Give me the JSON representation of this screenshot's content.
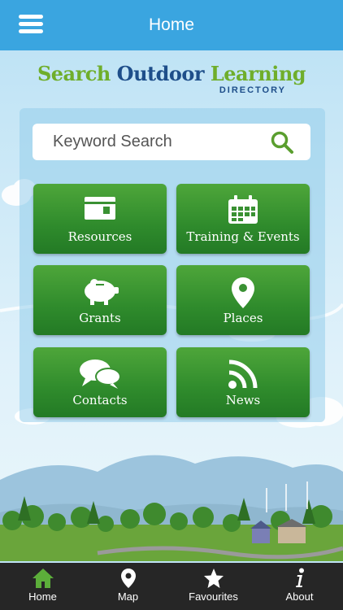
{
  "header": {
    "title": "Home"
  },
  "logo": {
    "word1": "Search",
    "word2": "Outdoor",
    "word3": "Learning",
    "sub": "DIRECTORY"
  },
  "search": {
    "placeholder": "Keyword Search"
  },
  "tiles": [
    {
      "label": "Resources",
      "icon": "card-icon"
    },
    {
      "label": "Training & Events",
      "icon": "calendar-icon"
    },
    {
      "label": "Grants",
      "icon": "piggy-bank-icon"
    },
    {
      "label": "Places",
      "icon": "map-pin-icon"
    },
    {
      "label": "Contacts",
      "icon": "speech-bubbles-icon"
    },
    {
      "label": "News",
      "icon": "rss-icon"
    }
  ],
  "tabs": [
    {
      "label": "Home",
      "icon": "home-icon"
    },
    {
      "label": "Map",
      "icon": "map-pin-icon"
    },
    {
      "label": "Favourites",
      "icon": "star-icon"
    },
    {
      "label": "About",
      "icon": "info-icon"
    }
  ],
  "colors": {
    "header": "#3aa5e0",
    "tile": "#2f8b2c",
    "tabbar": "#262626",
    "active_tab": "#5cae3a"
  }
}
